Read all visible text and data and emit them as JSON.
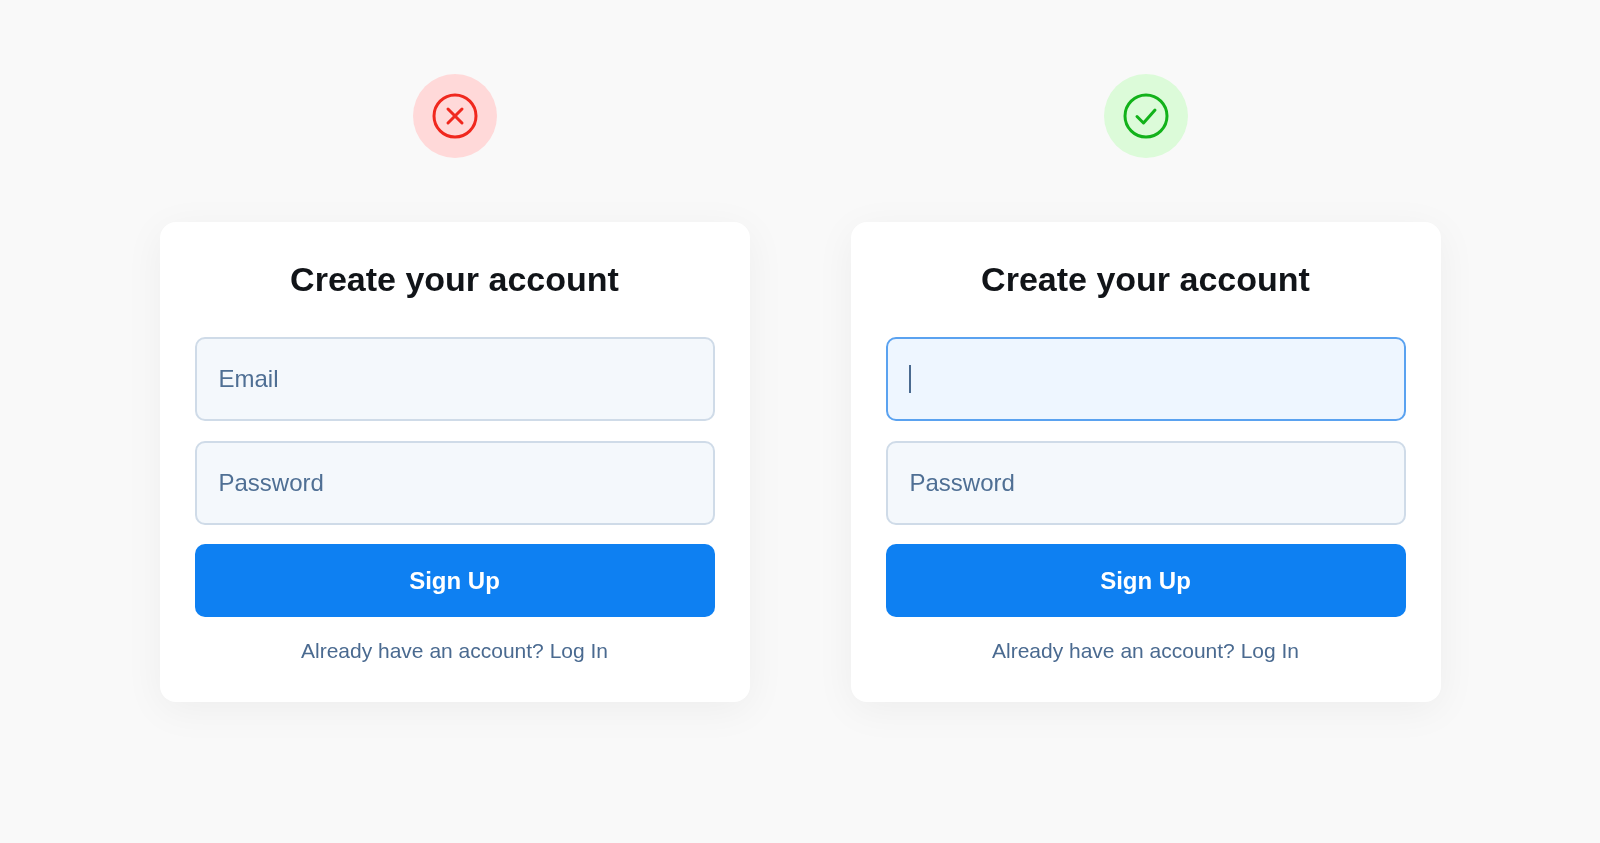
{
  "panels": [
    {
      "kind": "bad",
      "title": "Create your account",
      "fields": [
        {
          "placeholder": "Email",
          "focused": false
        },
        {
          "placeholder": "Password",
          "focused": false
        }
      ],
      "button": "Sign Up",
      "footer_link": "Already have an account? Log In"
    },
    {
      "kind": "good",
      "title": "Create your account",
      "fields": [
        {
          "focused": true
        },
        {
          "placeholder": "Password",
          "focused": false
        }
      ],
      "button": "Sign Up",
      "footer_link": "Already have an account? Log In"
    }
  ]
}
